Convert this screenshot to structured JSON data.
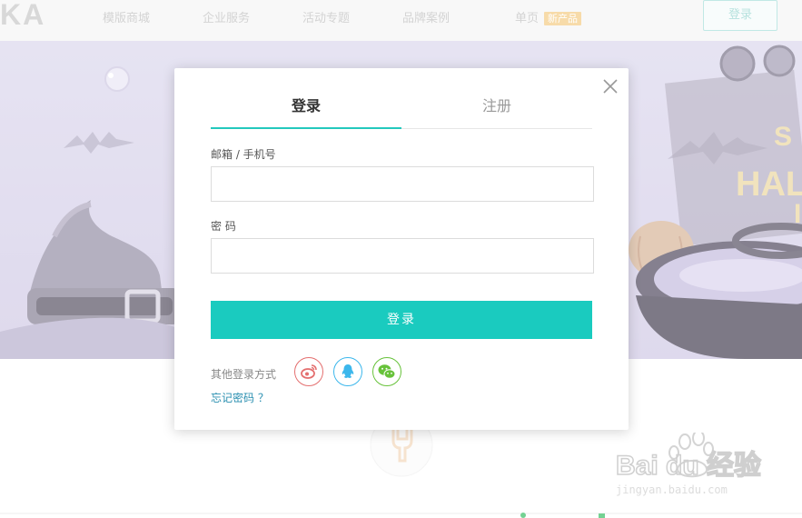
{
  "nav": {
    "logo": "KA",
    "items": [
      "模版商城",
      "企业服务",
      "活动专题",
      "品牌案例",
      "单页"
    ],
    "badge": "新产品",
    "login_button": "登录"
  },
  "hero": {
    "sign_text_1": "S",
    "sign_text_2": "HAL",
    "sign_text_3": "I"
  },
  "modal": {
    "tabs": [
      "登录",
      "注册"
    ],
    "email_label": "邮箱 / 手机号",
    "email_value": "",
    "password_label": "密 码",
    "password_value": "",
    "submit_label": "登录",
    "other_login_label": "其他登录方式",
    "social": [
      {
        "name": "weibo",
        "color": "#e46f6f"
      },
      {
        "name": "qq",
        "color": "#3cb7ec"
      },
      {
        "name": "wechat",
        "color": "#67c23a"
      }
    ],
    "forgot_label": "忘记密码 ？"
  },
  "watermark": {
    "brand": "Bai du 经验",
    "domain": "jingyan.baidu.com"
  },
  "colors": {
    "accent": "#1acbbf",
    "tab_underline": "#23c9bd",
    "link": "#2a8fb0"
  }
}
